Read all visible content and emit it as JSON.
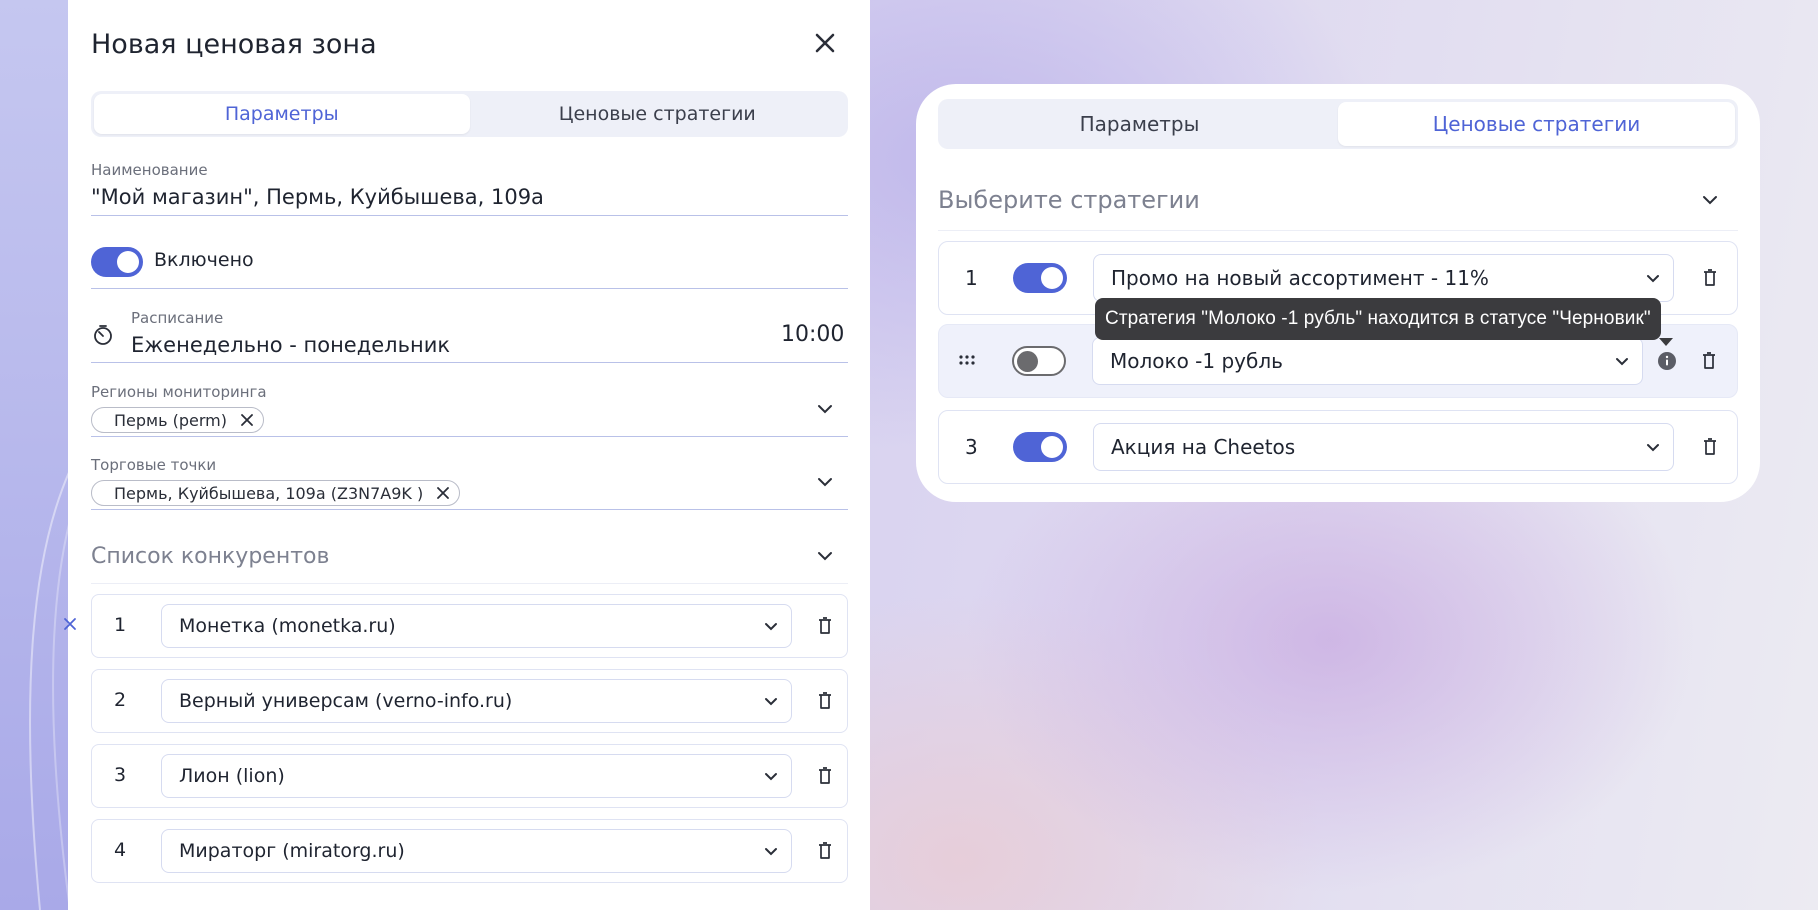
{
  "modal": {
    "title": "Новая ценовая зона",
    "tabs": [
      {
        "label": "Параметры",
        "active": true
      },
      {
        "label": "Ценовые стратегии",
        "active": false
      }
    ],
    "name_field": {
      "label": "Наименование",
      "value": "\"Мой магазин\", Пермь, Куйбышева, 109а"
    },
    "enabled_toggle": {
      "label": "Включено",
      "on": true
    },
    "schedule": {
      "label": "Расписание",
      "value": "Еженедельно - понедельник",
      "time": "10:00"
    },
    "regions": {
      "label": "Регионы мониторинга",
      "chips": [
        "Пермь (perm)"
      ]
    },
    "stores": {
      "label": "Торговые точки",
      "chips": [
        "Пермь, Куйбышева, 109а (Z3N7A9K )"
      ]
    },
    "competitors": {
      "title": "Список конкурентов",
      "rows": [
        {
          "num": "1",
          "value": "Монетка (monetka.ru)"
        },
        {
          "num": "2",
          "value": "Верный универсам (verno-info.ru)"
        },
        {
          "num": "3",
          "value": "Лион (lion)"
        },
        {
          "num": "4",
          "value": "Мираторг (miratorg.ru)"
        }
      ]
    }
  },
  "strategies_card": {
    "tabs": [
      {
        "label": "Параметры",
        "active": false
      },
      {
        "label": "Ценовые стратегии",
        "active": true
      }
    ],
    "select_title": "Выберите стратегии",
    "rows": [
      {
        "num": "1",
        "toggle_on": true,
        "value": "Промо на новый ассортимент - 11%"
      },
      {
        "num": "",
        "toggle_on": false,
        "value": "Молоко -1 рубль"
      },
      {
        "num": "3",
        "toggle_on": true,
        "value": "Акция на Cheetos"
      }
    ],
    "tooltip": "Стратегия \"Молоко -1 рубль\" находится в статусе \"Черновик\""
  },
  "colors": {
    "accent": "#4f64d6",
    "toggle_off": "#6b6b6e",
    "tooltip_bg": "#3b3b3e"
  }
}
